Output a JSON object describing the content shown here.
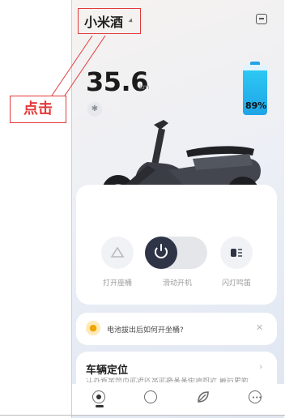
{
  "header": {
    "vehicle_name": "小米酒"
  },
  "callout": {
    "label": "点击"
  },
  "status": {
    "mileage": "35.6",
    "mileage_unit": "km",
    "battery_percent": "89%",
    "battery_level": 0.89
  },
  "controls": [
    {
      "label": "打开座桶",
      "icon": "seat-icon"
    },
    {
      "label": "滑动开机",
      "icon": "power-icon"
    },
    {
      "label": "闪灯鸣笛",
      "icon": "light-horn-icon"
    }
  ],
  "tip": {
    "text": "电池拔出后如何开坐桶?"
  },
  "location": {
    "title": "车辆定位",
    "subtitle": "江苏省常州市武进区常武路某某街道附近 最后更新"
  },
  "nav": [
    "home-icon",
    "chat-icon",
    "leaf-icon",
    "more-icon"
  ],
  "colors": {
    "accent": "#1fa4e8",
    "callout": "#e23a3a",
    "dark": "#2f3547"
  }
}
